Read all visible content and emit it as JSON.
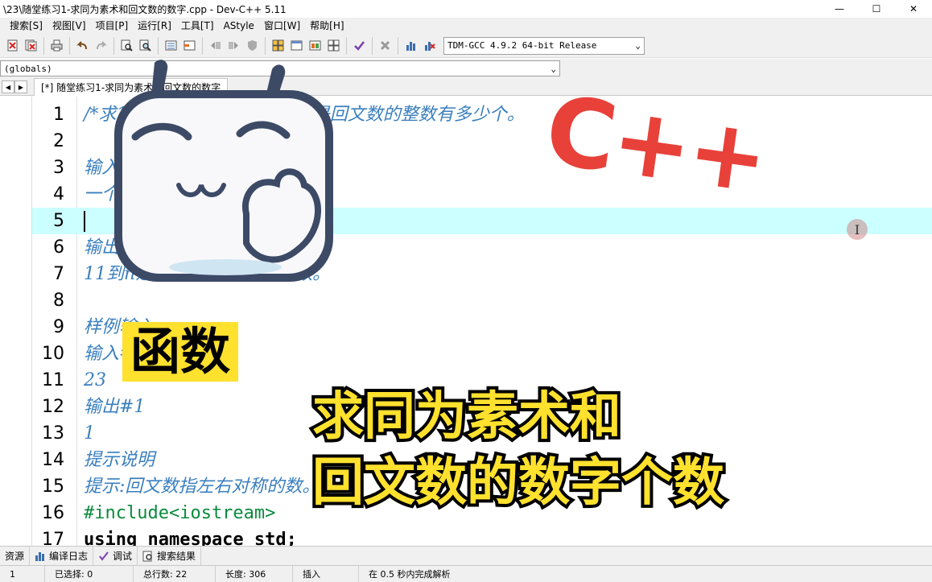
{
  "window": {
    "title": "\\23\\随堂练习1-求同为素术和回文数的数字.cpp - Dev-C++ 5.11"
  },
  "menu": [
    "搜索[S]",
    "视图[V]",
    "项目[P]",
    "运行[R]",
    "工具[T]",
    "AStyle",
    "窗口[W]",
    "帮助[H]"
  ],
  "toolbar": {
    "compiler": "TDM-GCC 4.9.2 64-bit Release"
  },
  "globals": "(globals)",
  "tab": {
    "label": "[*] 随堂练习1-求同为素术和回文数的数字"
  },
  "editor": {
    "active_line": 5,
    "lines": [
      {
        "n": "1",
        "text": "/*求11到n（n），既是素数又是回文数的整数有多少个。",
        "style": "comment"
      },
      {
        "n": "2",
        "text": "",
        "style": "comment"
      },
      {
        "n": "3",
        "text": "输入",
        "style": "comment"
      },
      {
        "n": "4",
        "text": "一个大于11小于1000的整数n。",
        "style": "comment"
      },
      {
        "n": "5",
        "text": "",
        "style": "comment"
      },
      {
        "n": "6",
        "text": "输出",
        "style": "comment"
      },
      {
        "n": "7",
        "text": "11到n之间的素数回文数个数。",
        "style": "comment"
      },
      {
        "n": "8",
        "text": "",
        "style": "comment"
      },
      {
        "n": "9",
        "text": "样例输入",
        "style": "comment"
      },
      {
        "n": "10",
        "text": "输入#1",
        "style": "comment"
      },
      {
        "n": "11",
        "text": "23",
        "style": "comment"
      },
      {
        "n": "12",
        "text": "输出#1",
        "style": "comment"
      },
      {
        "n": "13",
        "text": "1",
        "style": "comment"
      },
      {
        "n": "14",
        "text": "提示说明",
        "style": "comment"
      },
      {
        "n": "15",
        "text": "提示:回文数指左右对称的数。*/",
        "style": "comment"
      },
      {
        "n": "16",
        "text": "#include<iostream>",
        "style": "pre"
      },
      {
        "n": "17",
        "text": "using namespace std;",
        "style": "kw"
      }
    ]
  },
  "bottom_tabs": [
    "资源",
    "编译日志",
    "调试",
    "搜索结果"
  ],
  "status": {
    "line": "1",
    "selected_label": "已选择:",
    "selected": "0",
    "total_label": "总行数:",
    "total": "22",
    "length_label": "长度:",
    "length": "306",
    "mode": "插入",
    "parse": "在 0.5 秒内完成解析"
  },
  "overlay": {
    "logo": "C++",
    "func": "函数",
    "title1": "求同为素术和",
    "title2": "回文数的数字个数"
  },
  "colors": {
    "comment": "#3a7fbf",
    "active_line": "#ccffff",
    "logo": "#e8413a",
    "label_yellow": "#ffe12e"
  }
}
